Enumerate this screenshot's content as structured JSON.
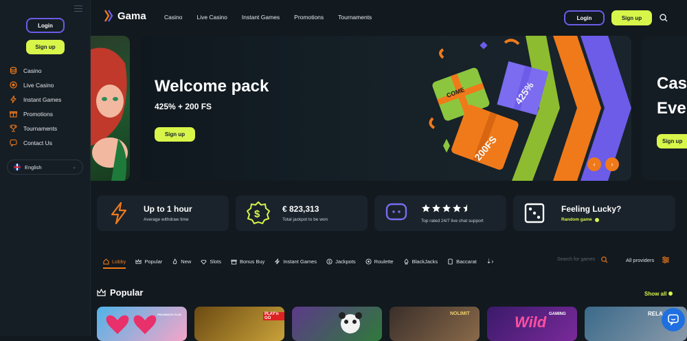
{
  "brand": {
    "name": "Gama",
    "accent": "#d8f54a",
    "secondary": "#6c5ce7",
    "orange": "#f07a1a"
  },
  "sidebar": {
    "login_label": "Login",
    "signup_label": "Sign up",
    "items": [
      {
        "label": "Casino",
        "icon": "coins-icon"
      },
      {
        "label": "Live Casino",
        "icon": "live-icon"
      },
      {
        "label": "Instant Games",
        "icon": "lightning-icon"
      },
      {
        "label": "Promotions",
        "icon": "gift-icon"
      },
      {
        "label": "Tournaments",
        "icon": "trophy-icon"
      },
      {
        "label": "Contact Us",
        "icon": "chat-icon"
      }
    ],
    "language": "English"
  },
  "header": {
    "nav": [
      "Casino",
      "Live Casino",
      "Instant Games",
      "Promotions",
      "Tournaments"
    ],
    "login_label": "Login",
    "signup_label": "Sign up"
  },
  "banner": {
    "title": "Welcome pack",
    "subtitle": "425% + 200 FS",
    "cta": "Sign up",
    "gift_texts": [
      "425%",
      "200FS",
      "COME"
    ],
    "next_partial_title_1": "Cas",
    "next_partial_title_2": "Eve",
    "next_cta": "Sign up"
  },
  "stats": [
    {
      "title": "Up to 1 hour",
      "sub": "Average withdraw time",
      "icon": "lightning-icon"
    },
    {
      "title": "€ 823,313",
      "sub": "Total jackpot to be won",
      "icon": "dollar-badge-icon"
    },
    {
      "title": "",
      "sub": "Top rated 24/7 live chat support",
      "icon": "chat-bubble-icon",
      "rating": 4.5
    },
    {
      "title": "Feeling Lucky?",
      "sub": "Random game",
      "icon": "dice-icon"
    }
  ],
  "categories": [
    {
      "label": "Lobby",
      "icon": "home-icon",
      "active": true
    },
    {
      "label": "Popular",
      "icon": "crown-icon"
    },
    {
      "label": "New",
      "icon": "flame-icon"
    },
    {
      "label": "Slots",
      "icon": "diamond-icon"
    },
    {
      "label": "Bonus Buy",
      "icon": "gift-icon"
    },
    {
      "label": "Instant Games",
      "icon": "lightning-icon"
    },
    {
      "label": "Jackpots",
      "icon": "coin-icon"
    },
    {
      "label": "Roulette",
      "icon": "roulette-icon"
    },
    {
      "label": "BlackJacks",
      "icon": "spade-icon"
    },
    {
      "label": "Baccarat",
      "icon": "card-icon"
    }
  ],
  "search_placeholder": "Search for games",
  "providers_label": "All providers",
  "popular": {
    "title": "Popular",
    "show_all": "Show all",
    "thumb_labels": [
      "PRAGMATIC PLAY",
      "PLAY'n GO",
      "NOLIMIT",
      "GAMING",
      "RELA"
    ],
    "wild_text": "Wild"
  }
}
